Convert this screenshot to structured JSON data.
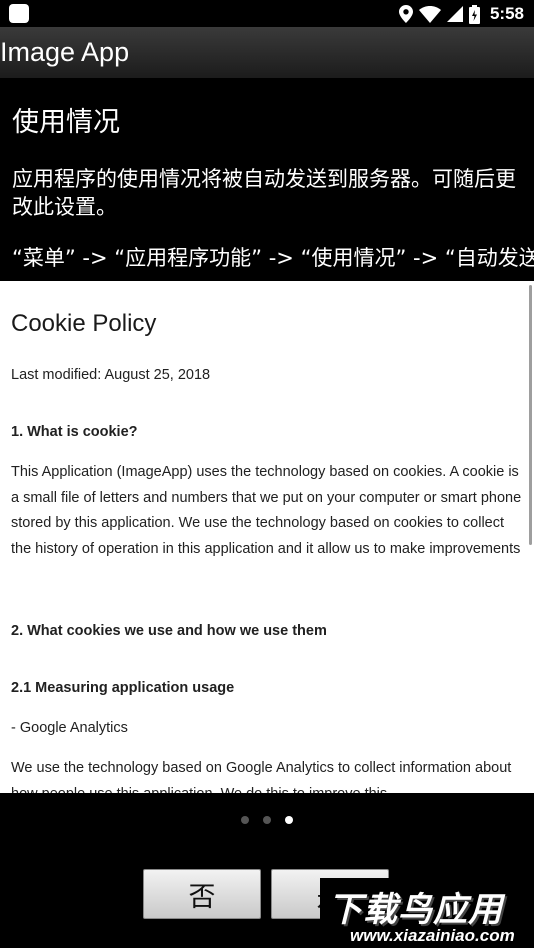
{
  "status_bar": {
    "time": "5:58"
  },
  "app_bar": {
    "title": "Image App"
  },
  "usage": {
    "title": "使用情况",
    "description": "应用程序的使用情况将被自动发送到服务器。可随后更改此设置。",
    "path": "“菜单” -> “应用程序功能” -> “使用情况” -> “自动发送”"
  },
  "policy": {
    "title": "Cookie Policy",
    "last_modified": "Last modified: August 25, 2018",
    "h1": "1. What is cookie?",
    "p1": "This Application (ImageApp) uses the technology based on cookies. A cookie is a small file of letters and numbers that we put on your computer or smart phone stored by this application. We use the technology based on cookies to collect the history of operation in this application and it allow us to make improvements",
    "h2": "2. What cookies we use and how we use them",
    "h21": "2.1 Measuring application usage",
    "p21": "- Google Analytics",
    "p22": "We use the technology based on Google Analytics to collect information about how people use this application. We do this to improve this"
  },
  "pager": {
    "count": 3,
    "active_index": 2
  },
  "buttons": {
    "no_label": "否",
    "yes_label": "是"
  },
  "watermark": {
    "main": "下载鸟应用",
    "url": "www.xiazainiao.com"
  }
}
